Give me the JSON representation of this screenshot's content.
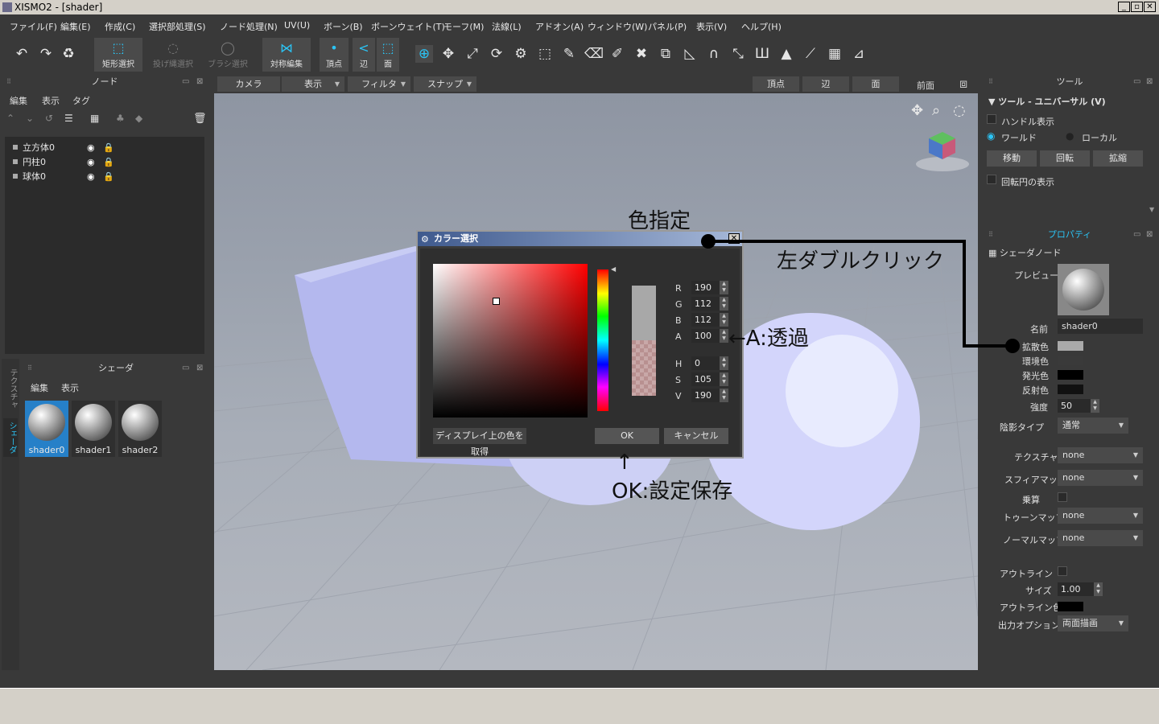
{
  "window": {
    "title": "XISMO2 - [shader]",
    "min": "_",
    "max": "▫",
    "close": "✕"
  },
  "menu": [
    "ファイル(F)",
    "編集(E)",
    "作成(C)",
    "選択部処理(S)",
    "ノード処理(N)",
    "UV(U)",
    "ボーン(B)",
    "ボーンウェイト(T)",
    "モーフ(M)",
    "法線(L)",
    "アドオン(A)",
    "ウィンドウ(W)",
    "パネル(P)",
    "表示(V)",
    "ヘルプ(H)"
  ],
  "toolbar": {
    "rect_select": "矩形選択",
    "lasso_select": "投げ縄選択",
    "brush_select": "ブラシ選択",
    "symmetric": "対称編集",
    "vertex": "頂点",
    "edge": "辺",
    "face": "面"
  },
  "node_panel": {
    "title": "ノード",
    "menus": [
      "編集",
      "表示",
      "タグ"
    ],
    "items": [
      "立方体0",
      "円柱0",
      "球体0"
    ]
  },
  "shader_panel": {
    "title": "シェーダ",
    "menus": [
      "編集",
      "表示"
    ],
    "side_tabs": [
      "テクスチャ",
      "シェーダ"
    ],
    "items": [
      "shader0",
      "shader1",
      "shader2"
    ]
  },
  "viewport": {
    "tabs": [
      "カメラ",
      "表示",
      "フィルタ",
      "スナップ"
    ],
    "mode_tabs": [
      "頂点",
      "辺",
      "面"
    ],
    "view_name": "前面"
  },
  "tool_panel": {
    "title": "ツール",
    "section": "ツール - ユニバーサル (V)",
    "handle": "ハンドル表示",
    "world": "ワールド",
    "local": "ローカル",
    "move": "移動",
    "rotate": "回転",
    "scale": "拡縮",
    "rotate_circle": "回転円の表示"
  },
  "properties": {
    "title": "プロパティ",
    "section": "シェーダノード",
    "preview": "プレビュー",
    "name_label": "名前",
    "name_value": "shader0",
    "diffuse": "拡散色",
    "ambient": "環境色",
    "emissive": "発光色",
    "specular": "反射色",
    "strength_label": "強度",
    "strength_value": "50",
    "shade_label": "陰影タイプ",
    "shade_value": "通常",
    "texture_label": "テクスチャ",
    "texture_value": "none",
    "sphere_label": "スフィアマップ",
    "sphere_value": "none",
    "multiply_label": "乗算",
    "toon_label": "トゥーンマップ",
    "toon_value": "none",
    "normal_label": "ノーマルマップ",
    "normal_value": "none",
    "outline_label": "アウトライン",
    "size_label": "サイズ",
    "size_value": "1.00",
    "outline_color_label": "アウトライン色",
    "output_label": "出力オプション",
    "output_value": "両面描画"
  },
  "colors": {
    "diffuse": "#aaaaaa",
    "ambient": "#3a3a3a",
    "emissive": "#000000",
    "specular": "#111111",
    "outline": "#000000",
    "accent": "#2bc4f5",
    "selected_blue": "#2680c8"
  },
  "dialog": {
    "title": "カラー選択",
    "R": "190",
    "G": "112",
    "B": "112",
    "A": "100",
    "H": "0",
    "S": "105",
    "V": "190",
    "labels": {
      "R": "R",
      "G": "G",
      "B": "B",
      "A": "A",
      "H": "H",
      "S": "S",
      "V": "V"
    },
    "pick": "ディスプレイ上の色を取得",
    "ok": "OK",
    "cancel": "キャンセル",
    "preview_color": "#a8a8a8"
  },
  "annotations": {
    "color": "色指定",
    "dblclick": "左ダブルクリック",
    "alpha": "←A:透過",
    "ok_arrow": "↑",
    "ok": "OK:設定保存"
  }
}
